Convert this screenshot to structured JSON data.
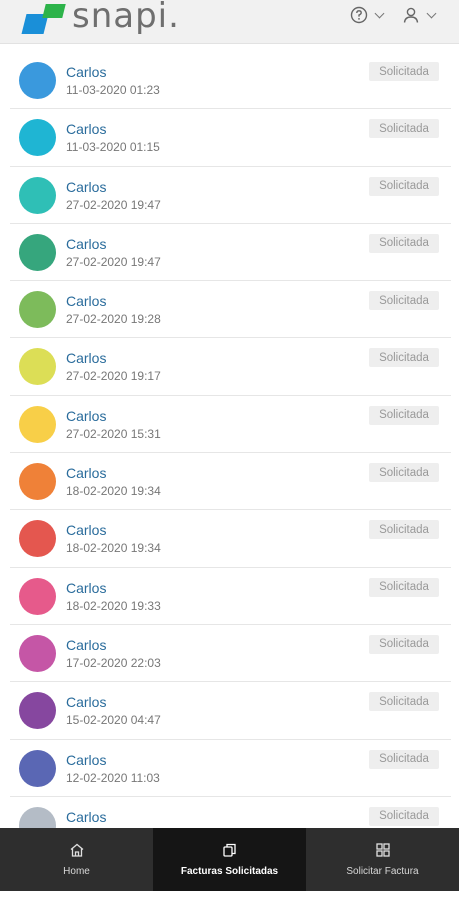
{
  "brand": {
    "name": "snapi."
  },
  "header": {
    "help_icon": "help-circle-icon",
    "user_icon": "user-icon"
  },
  "invoices": [
    {
      "name": "Carlos",
      "date": "11-03-2020 01:23",
      "status": "Solicitada",
      "color": "#3a99dd"
    },
    {
      "name": "Carlos",
      "date": "11-03-2020 01:15",
      "status": "Solicitada",
      "color": "#1fb5d3"
    },
    {
      "name": "Carlos",
      "date": "27-02-2020 19:47",
      "status": "Solicitada",
      "color": "#2fbfb6"
    },
    {
      "name": "Carlos",
      "date": "27-02-2020 19:47",
      "status": "Solicitada",
      "color": "#36a67d"
    },
    {
      "name": "Carlos",
      "date": "27-02-2020 19:28",
      "status": "Solicitada",
      "color": "#7dbb5b"
    },
    {
      "name": "Carlos",
      "date": "27-02-2020 19:17",
      "status": "Solicitada",
      "color": "#dcde56"
    },
    {
      "name": "Carlos",
      "date": "27-02-2020 15:31",
      "status": "Solicitada",
      "color": "#f8cf48"
    },
    {
      "name": "Carlos",
      "date": "18-02-2020 19:34",
      "status": "Solicitada",
      "color": "#ef8138"
    },
    {
      "name": "Carlos",
      "date": "18-02-2020 19:34",
      "status": "Solicitada",
      "color": "#e4574f"
    },
    {
      "name": "Carlos",
      "date": "18-02-2020 19:33",
      "status": "Solicitada",
      "color": "#e65a8b"
    },
    {
      "name": "Carlos",
      "date": "17-02-2020 22:03",
      "status": "Solicitada",
      "color": "#c556a6"
    },
    {
      "name": "Carlos",
      "date": "15-02-2020 04:47",
      "status": "Solicitada",
      "color": "#86479f"
    },
    {
      "name": "Carlos",
      "date": "12-02-2020 11:03",
      "status": "Solicitada",
      "color": "#5a67b4"
    },
    {
      "name": "Carlos",
      "date": "",
      "status": "Solicitada",
      "color": "#b4bcc6"
    }
  ],
  "nav": {
    "items": [
      {
        "label": "Home",
        "icon": "home-icon"
      },
      {
        "label": "Facturas Solicitadas",
        "icon": "copy-icon"
      },
      {
        "label": "Solicitar Factura",
        "icon": "grid-icon"
      }
    ]
  }
}
